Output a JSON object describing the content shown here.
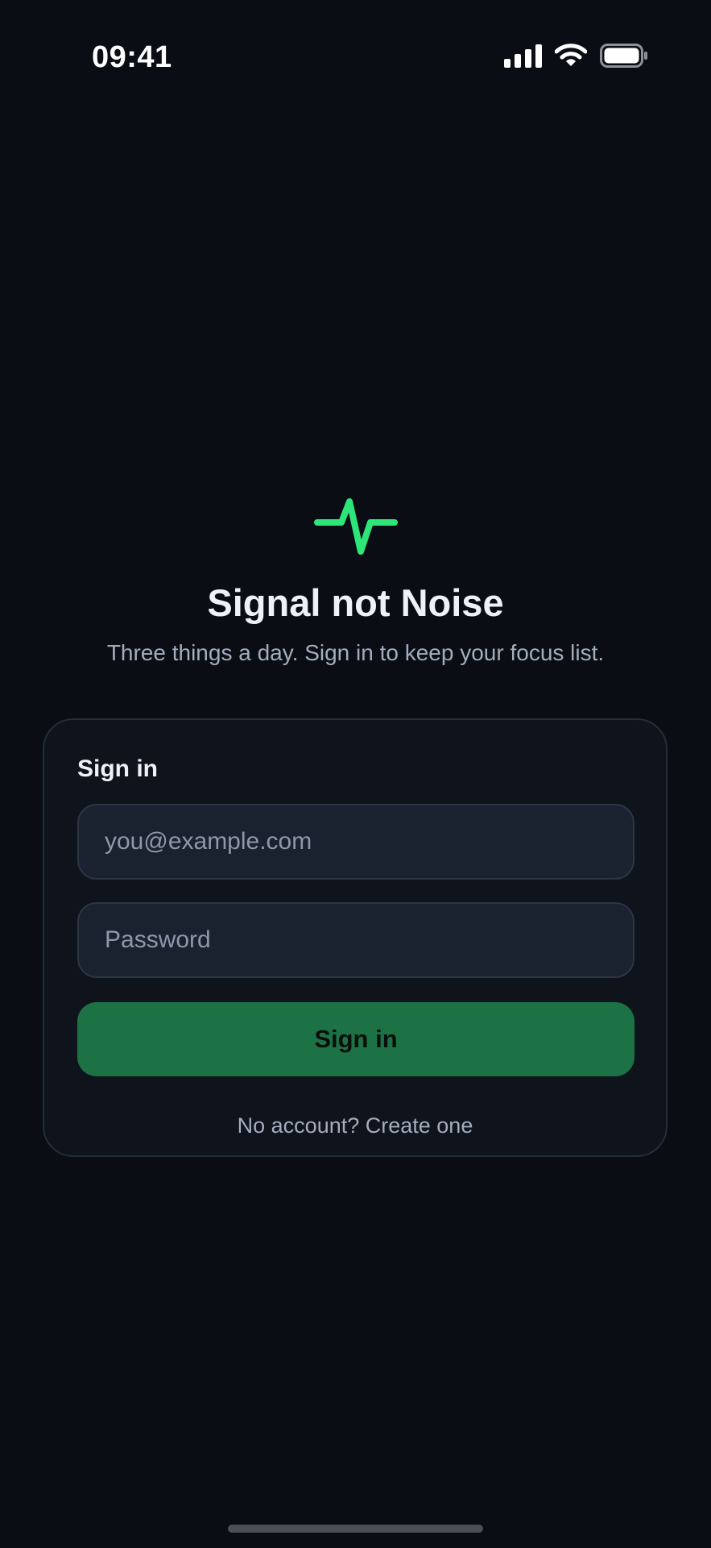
{
  "status_bar": {
    "time": "09:41",
    "icons": [
      "cellular-signal-icon",
      "wifi-icon",
      "battery-icon"
    ]
  },
  "hero": {
    "logo_icon": "pulse-icon",
    "title": "Signal not Noise",
    "tagline": "Three things a day. Sign in to keep your focus list."
  },
  "card": {
    "title": "Sign in",
    "email_field": {
      "placeholder": "you@example.com",
      "value": ""
    },
    "password_field": {
      "placeholder": "Password",
      "value": ""
    },
    "submit_label": "Sign in",
    "create_account_text": "No account? Create one"
  },
  "colors": {
    "background": "#0a0d14",
    "accent": "#2ee57a",
    "button": "#1c7245",
    "card": "#0f141c",
    "field": "#1a2230"
  }
}
